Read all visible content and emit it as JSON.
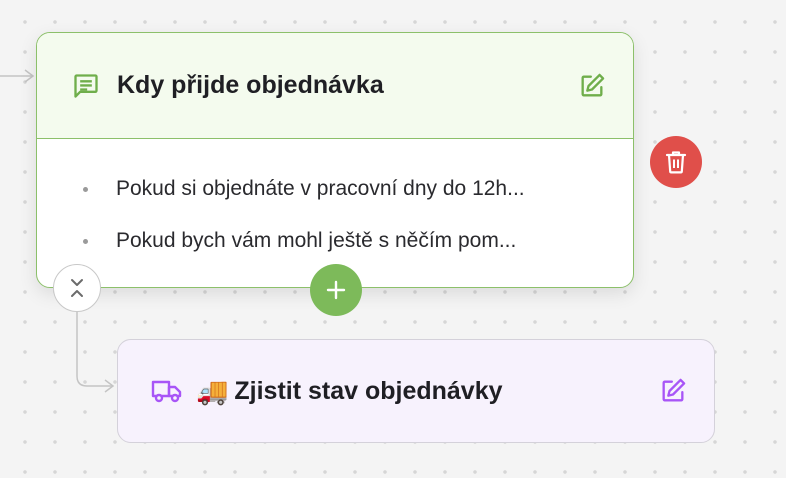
{
  "message_node": {
    "title": "Kdy přijde objednávka",
    "type_icon": "chat-message-icon",
    "edit_icon": "edit-icon",
    "lines": [
      "Pokud si objednáte v pracovní dny do 12h...",
      "Pokud bych vám mohl ještě s něčím pom..."
    ],
    "accent_color": "#8cc06a",
    "header_bg": "#f4fbee"
  },
  "action_node": {
    "emoji": "🚚",
    "title": "Zjistit stav objednávky",
    "type_icon": "truck-icon",
    "edit_icon": "edit-icon",
    "accent_color": "#a855f7",
    "bg": "#f7f2fd"
  },
  "controls": {
    "delete_icon": "trash-icon",
    "delete_color": "#e04f4a",
    "add_icon": "plus-icon",
    "add_color": "#7dba5a",
    "collapse_icon": "collapse-chevrons-icon"
  }
}
